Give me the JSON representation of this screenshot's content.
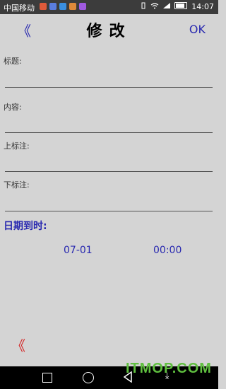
{
  "status_bar": {
    "carrier": "中国移动",
    "time": "14:07",
    "app_icon_colors": [
      "#e05a3a",
      "#5a7de0",
      "#3a8fe0",
      "#e08a3a",
      "#a05ae0"
    ]
  },
  "header": {
    "back_label": "《",
    "title": "修改",
    "ok_label": "OK"
  },
  "form": {
    "title_label": "标题:",
    "title_value": "",
    "content_label": "内容:",
    "content_value": "",
    "upper_note_label": "上标注:",
    "upper_note_value": "",
    "lower_note_label": "下标注:",
    "lower_note_value": ""
  },
  "date": {
    "label": "日期到时:",
    "date_value": "07-01",
    "time_value": "00:00"
  },
  "bottom": {
    "back_label": "《"
  },
  "watermark": "ITMOP.COM",
  "colors": {
    "accent": "#2a2ab0",
    "danger": "#d42a2a",
    "background": "#d4d4d4"
  }
}
